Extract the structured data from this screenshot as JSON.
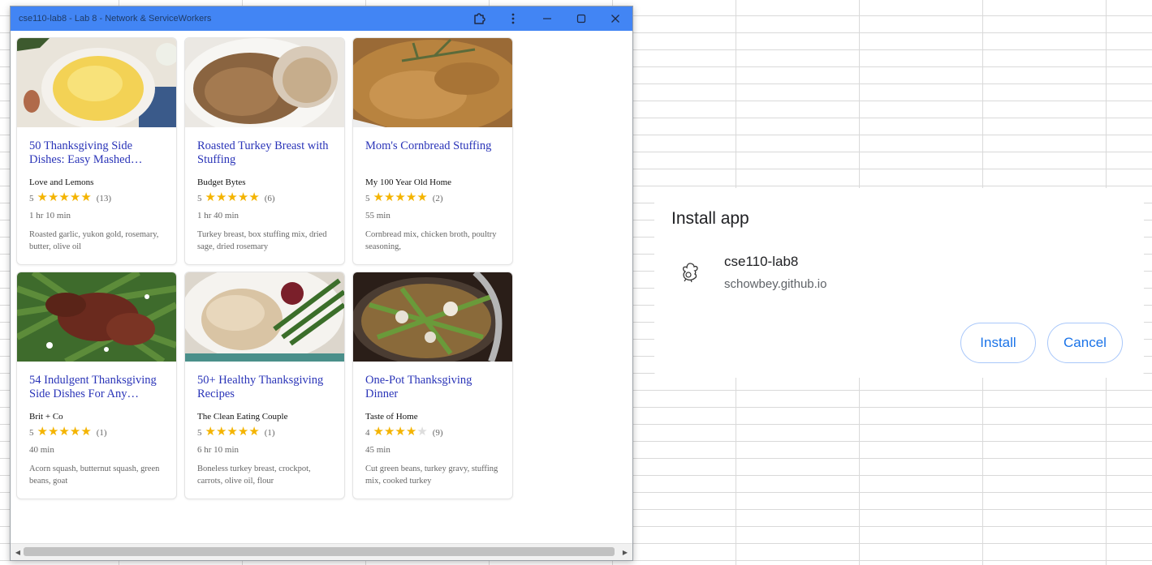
{
  "window": {
    "title": "cse110-lab8 - Lab 8 - Network & ServiceWorkers",
    "titlebar_color": "#4285f4"
  },
  "recipes": [
    {
      "title": "50 Thanksgiving Side Dishes: Easy Mashed…",
      "org": "Love and Lemons",
      "rating": "5",
      "stars": 5,
      "reviews": "(13)",
      "time": "1 hr 10 min",
      "ingredients": "Roasted garlic, yukon gold, rosemary, butter, olive oil"
    },
    {
      "title": "Roasted Turkey Breast with Stuffing",
      "org": "Budget Bytes",
      "rating": "5",
      "stars": 5,
      "reviews": "(6)",
      "time": "1 hr 40 min",
      "ingredients": "Turkey breast, box stuffing mix, dried sage, dried rosemary"
    },
    {
      "title": "Mom's Cornbread Stuffing",
      "org": "My 100 Year Old Home",
      "rating": "5",
      "stars": 5,
      "reviews": "(2)",
      "time": "55 min",
      "ingredients": "Cornbread mix, chicken broth, poultry seasoning,"
    },
    {
      "title": "54 Indulgent Thanksgiving Side Dishes For Any…",
      "org": "Brit + Co",
      "rating": "5",
      "stars": 5,
      "reviews": "(1)",
      "time": "40 min",
      "ingredients": "Acorn squash, butternut squash, green beans, goat"
    },
    {
      "title": "50+ Healthy Thanksgiving Recipes",
      "org": "The Clean Eating Couple",
      "rating": "5",
      "stars": 5,
      "reviews": "(1)",
      "time": "6 hr 10 min",
      "ingredients": "Boneless turkey breast, crockpot, carrots, olive oil, flour"
    },
    {
      "title": "One-Pot Thanksgiving Dinner",
      "org": "Taste of Home",
      "rating": "4",
      "stars": 4,
      "reviews": "(9)",
      "time": "45 min",
      "ingredients": "Cut green beans, turkey gravy, stuffing mix, cooked turkey"
    }
  ],
  "dialog": {
    "heading": "Install app",
    "app_name": "cse110-lab8",
    "origin": "schowbey.github.io",
    "install_label": "Install",
    "cancel_label": "Cancel",
    "accent": "#1a73e8"
  },
  "icons": {
    "extensions": "puzzle-icon",
    "menu": "more-vert-icon",
    "minimize": "minimize-icon",
    "maximize": "maximize-icon",
    "close": "close-icon",
    "app": "turkey-icon"
  },
  "star_color": "#f4b400",
  "link_color": "#2a34b8"
}
